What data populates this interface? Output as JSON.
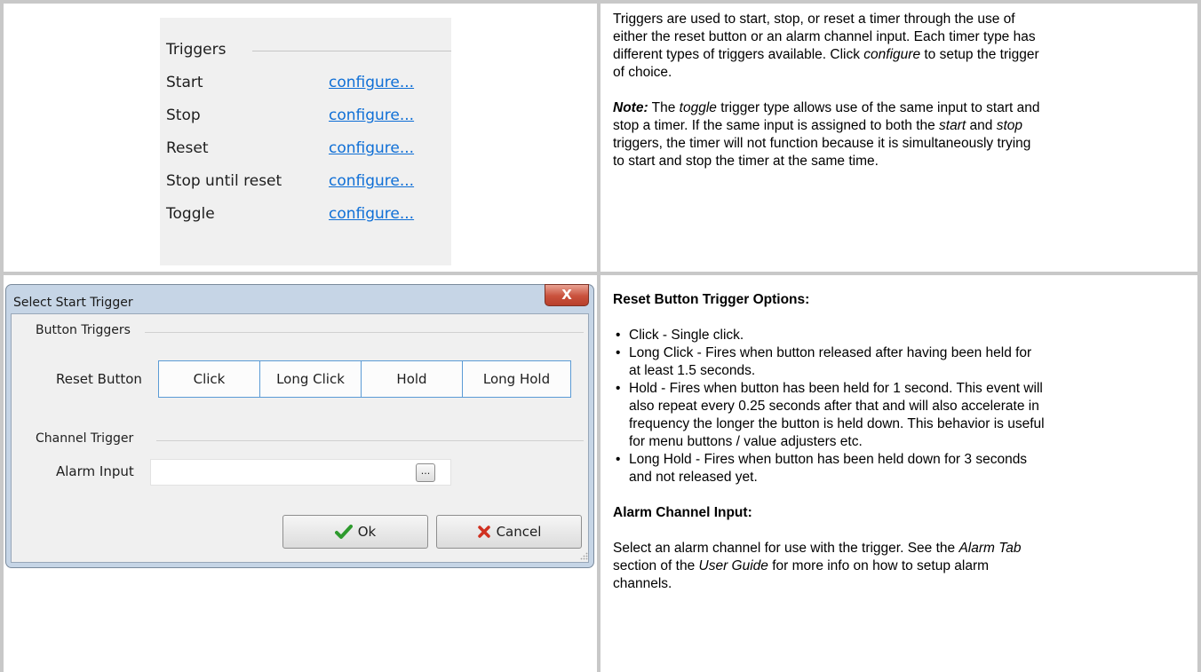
{
  "triggers_panel": {
    "heading": "Triggers",
    "rows": [
      {
        "label": "Start",
        "link": "configure..."
      },
      {
        "label": "Stop",
        "link": "configure..."
      },
      {
        "label": "Reset",
        "link": "configure..."
      },
      {
        "label": "Stop until reset",
        "link": "configure..."
      },
      {
        "label": "Toggle",
        "link": "configure..."
      }
    ]
  },
  "description": {
    "intro": [
      {
        "text": "Triggers are used to start, stop, or reset a timer through the use of",
        "style": "normal"
      },
      {
        "text": "either the reset button or an alarm channel input. Each timer type has",
        "style": "normal"
      },
      {
        "text": "different types of triggers available. Click ",
        "style": "normal"
      }
    ],
    "intro_italic": "configure",
    "intro_tail": " to setup the trigger",
    "intro_last": "of choice.",
    "note_label": "Note:",
    "note_1": " The ",
    "note_toggle": "toggle",
    "note_2": " trigger type allows use of the same input to start and",
    "note_3": "stop a timer. If the same input is assigned to both the ",
    "note_start": "start",
    "note_and": " and ",
    "note_stop": "stop",
    "note_4": "triggers, the timer will not function because it is simultaneously trying",
    "note_5": "to start and stop the timer at the same time."
  },
  "dialog": {
    "title": "Select Start Trigger",
    "close_glyph": "X",
    "button_triggers_label": "Button Triggers",
    "reset_button_label": "Reset Button",
    "segments": [
      "Click",
      "Long Click",
      "Hold",
      "Long Hold"
    ],
    "channel_trigger_label": "Channel Trigger",
    "alarm_input_label": "Alarm Input",
    "alarm_input_value": "",
    "browse_label": "...",
    "ok_label": "Ok",
    "cancel_label": "Cancel",
    "ok_icon": "checkmark-icon",
    "cancel_icon": "x-icon",
    "colors": {
      "ok_icon": "#2e9a2e",
      "cancel_icon": "#d03020",
      "segment_border": "#5b9bd5"
    }
  },
  "options": {
    "reset_heading": "Reset Button Trigger Options:",
    "bullets": [
      [
        "Click - Single click."
      ],
      [
        "Long Click - Fires when button released after having been held for",
        "at least 1.5 seconds."
      ],
      [
        "Hold - Fires when button has been held for 1 second. This event will",
        "also repeat every 0.25 seconds after that and will also accelerate in",
        "frequency the longer the button is held down. This behavior is useful",
        "for menu buttons / value adjusters etc."
      ],
      [
        "Long Hold - Fires when button has been held down for 3 seconds",
        "and not released yet."
      ]
    ],
    "alarm_heading": "Alarm Channel Input:",
    "alarm_1": "Select an alarm channel for use with the trigger. See the ",
    "alarm_tab": "Alarm Tab",
    "alarm_2": "section of the ",
    "alarm_guide": "User Guide",
    "alarm_3": " for more info on how to setup alarm",
    "alarm_4": "channels."
  }
}
